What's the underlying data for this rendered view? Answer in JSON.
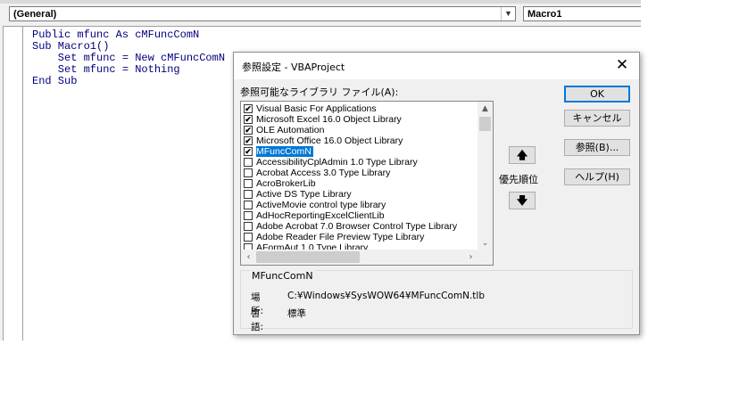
{
  "editor": {
    "object_combo": "(General)",
    "proc_combo": "Macro1",
    "code_lines": [
      "Public mfunc As cMFuncComN",
      "Sub Macro1()",
      "    Set mfunc = New cMFuncComN",
      "    Set mfunc = Nothing",
      "End Sub"
    ]
  },
  "dialog": {
    "title": "参照設定 - VBAProject",
    "close_glyph": "✕",
    "list_label": "参照可能なライブラリ ファイル(A):",
    "libraries": [
      {
        "name": "Visual Basic For Applications",
        "checked": true,
        "selected": false
      },
      {
        "name": "Microsoft Excel 16.0 Object Library",
        "checked": true,
        "selected": false
      },
      {
        "name": "OLE Automation",
        "checked": true,
        "selected": false
      },
      {
        "name": "Microsoft Office 16.0 Object Library",
        "checked": true,
        "selected": false
      },
      {
        "name": "MFuncComN",
        "checked": true,
        "selected": true
      },
      {
        "name": "AccessibilityCplAdmin 1.0 Type Library",
        "checked": false,
        "selected": false
      },
      {
        "name": "Acrobat Access 3.0 Type Library",
        "checked": false,
        "selected": false
      },
      {
        "name": "AcroBrokerLib",
        "checked": false,
        "selected": false
      },
      {
        "name": "Active DS Type Library",
        "checked": false,
        "selected": false
      },
      {
        "name": "ActiveMovie control type library",
        "checked": false,
        "selected": false
      },
      {
        "name": "AdHocReportingExcelClientLib",
        "checked": false,
        "selected": false
      },
      {
        "name": "Adobe Acrobat 7.0 Browser Control Type Library",
        "checked": false,
        "selected": false
      },
      {
        "name": "Adobe Reader File Preview Type Library",
        "checked": false,
        "selected": false
      },
      {
        "name": "AFormAut 1.0 Type Library",
        "checked": false,
        "selected": false
      }
    ],
    "buttons": {
      "ok": "OK",
      "cancel": "キャンセル",
      "browse": "参照(B)...",
      "help": "ヘルプ(H)"
    },
    "priority_label": "優先順位",
    "priority_up_glyph": "🡅",
    "priority_down_glyph": "🡇",
    "info": {
      "title": "MFuncComN",
      "location_label": "場所:",
      "location_value": "C:¥Windows¥SysWOW64¥MFuncComN.tlb",
      "language_label": "言語:",
      "language_value": "標準"
    }
  }
}
